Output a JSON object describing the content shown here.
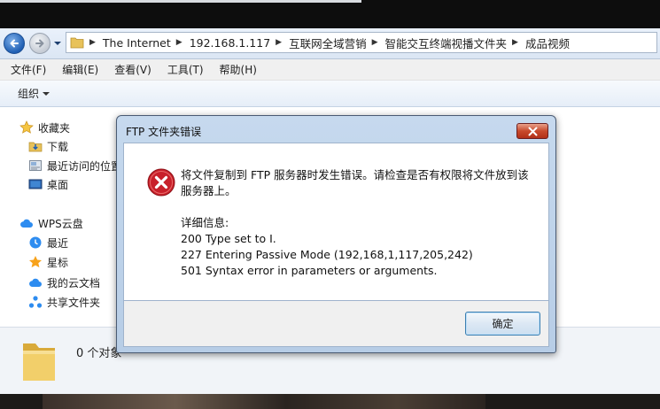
{
  "addressBar": {
    "crumbs": [
      "The Internet",
      "192.168.1.117",
      "互联网全域营销",
      "智能交互终端视播文件夹",
      "成品视频"
    ]
  },
  "menu": [
    "文件(F)",
    "编辑(E)",
    "查看(V)",
    "工具(T)",
    "帮助(H)"
  ],
  "toolbar": {
    "organize": "组织"
  },
  "navPane": {
    "favorites": "收藏夹",
    "downloads": "下载",
    "recent": "最近访问的位置",
    "desktop": "桌面",
    "wps": "WPS云盘",
    "wps_recent": "最近",
    "wps_starred": "星标",
    "wps_mydocs": "我的云文档",
    "wps_shared": "共享文件夹"
  },
  "details": {
    "itemCount": "0 个对象"
  },
  "dialog": {
    "title": "FTP 文件夹错误",
    "message": "将文件复制到 FTP 服务器时发生错误。请检查是否有权限将文件放到该服务器上。",
    "detailsHeader": "详细信息:",
    "detailLine1": "200 Type set to I.",
    "detailLine2": "227 Entering Passive Mode (192,168,1,117,205,242)",
    "detailLine3": "501 Syntax error in parameters or arguments.",
    "ok": "确定"
  },
  "colors": {
    "accent": "#1f5fb4",
    "errorRed": "#c8202a",
    "dialogFrame": "#b7cde6"
  }
}
